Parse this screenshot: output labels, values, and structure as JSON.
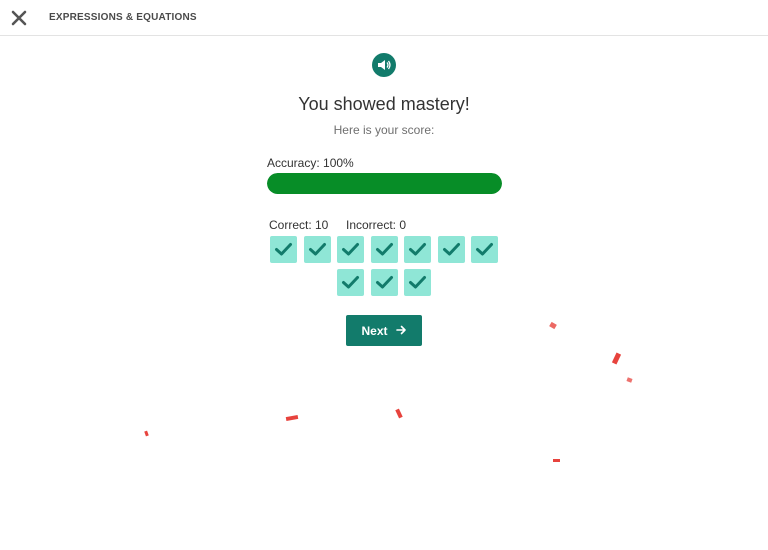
{
  "header": {
    "close_icon": "close-icon",
    "lesson_title": "EXPRESSIONS & EQUATIONS"
  },
  "audio": {
    "icon": "speaker-icon"
  },
  "results": {
    "heading": "You showed mastery!",
    "subheading": "Here is your score:",
    "accuracy_label": "Accuracy: 100%",
    "accuracy_fraction": 1.0,
    "correct_label": "Correct: 10",
    "incorrect_label": "Incorrect: 0",
    "answers": [
      "correct",
      "correct",
      "correct",
      "correct",
      "correct",
      "correct",
      "correct",
      "correct",
      "correct",
      "correct"
    ]
  },
  "next_button": {
    "label": "Next",
    "icon": "arrow-right-icon"
  },
  "colors": {
    "accent": "#127b6b",
    "progress": "#078d27",
    "tile": "#8fe6d6",
    "check": "#127b6b",
    "confetti": "#e7433d"
  }
}
